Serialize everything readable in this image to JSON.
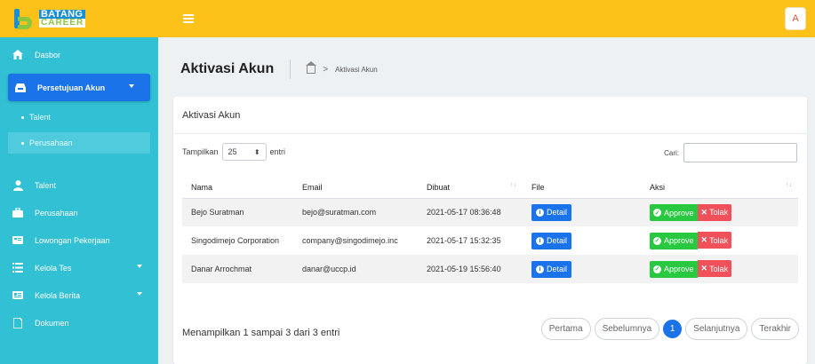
{
  "brand": {
    "line1": "BATANG",
    "line2": "CAREER"
  },
  "user": {
    "initial": "A"
  },
  "sidebar": {
    "items": [
      {
        "label": "Dasbor",
        "icon": "home-icon"
      },
      {
        "label": "Persetujuan Akun",
        "icon": "inbox-icon"
      },
      {
        "label": "Talent",
        "icon": "user-icon"
      },
      {
        "label": "Perusahaan",
        "icon": "briefcase-icon"
      },
      {
        "label": "Lowongan Pekerjaan",
        "icon": "card-icon"
      },
      {
        "label": "Kelola Tes",
        "icon": "list-icon"
      },
      {
        "label": "Kelola Berita",
        "icon": "newspaper-icon"
      },
      {
        "label": "Dokumen",
        "icon": "file-icon"
      }
    ],
    "subitems": [
      {
        "label": "Talent"
      },
      {
        "label": "Perusahaan"
      }
    ]
  },
  "page": {
    "title": "Aktivasi Akun",
    "breadcrumb": "Aktivasi Akun"
  },
  "card": {
    "title": "Aktivasi Akun",
    "show_label": "Tampilkan",
    "entries_value": "25",
    "entries_label": "entri",
    "search_label": "Cari:",
    "search_value": ""
  },
  "table": {
    "headers": [
      "Nama",
      "Email",
      "Dibuat",
      "File",
      "Aksi"
    ],
    "rows": [
      {
        "nama": "Bejo Suratman",
        "email": "bejo@suratman.com",
        "dibuat": "2021-05-17 08:36:48"
      },
      {
        "nama": "Singodimejo Corporation",
        "email": "company@singodimejo.inc",
        "dibuat": "2021-05-17 15:32:35"
      },
      {
        "nama": "Danar Arrochmat",
        "email": "danar@uccp.id",
        "dibuat": "2021-05-19 15:56:40"
      }
    ],
    "detail_label": "Detail",
    "approve_label": "Approve",
    "reject_label": "Tolak"
  },
  "footer": {
    "info": "Menampilkan 1 sampai 3 dari 3 entri",
    "first": "Pertama",
    "prev": "Sebelumnya",
    "current": "1",
    "next": "Selanjutnya",
    "last": "Terakhir"
  },
  "colors": {
    "topbar": "#fdc21a",
    "sidebar": "#31c0d4",
    "primary": "#1a73e8",
    "approve": "#28c940",
    "reject": "#f0505a"
  }
}
